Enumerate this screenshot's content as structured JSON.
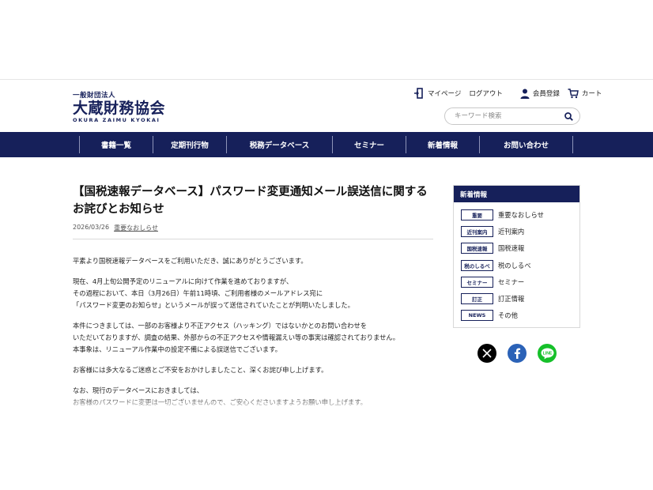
{
  "header": {
    "logo_small": "一般財団法人",
    "logo_big": "大蔵財務協会",
    "logo_roman": "OKURA ZAIMU KYOKAI",
    "mypage": "マイページ",
    "logout": "ログアウト",
    "member": "会員登録",
    "cart": "カート",
    "search_placeholder": "キーワード検索"
  },
  "nav": {
    "items": [
      "書籍一覧",
      "定期刊行物",
      "税務データベース",
      "セミナー",
      "新着情報",
      "お問い合わせ"
    ]
  },
  "article": {
    "title": "【国税速報データベース】パスワード変更通知メール誤送信に関するお詫びとお知らせ",
    "date": "2026/03/26",
    "category": "重要なおしらせ",
    "paragraphs": [
      [
        "平素より国税速報データベースをご利用いただき、誠にありがとうございます。"
      ],
      [
        "現在、4月上旬公開予定のリニューアルに向けて作業を進めておりますが、",
        "その過程において、本日（3月26日）午前11時頃、ご利用者様のメールアドレス宛に",
        "「パスワード変更のお知らせ」というメールが誤って送信されていたことが判明いたしました。"
      ],
      [
        "本件につきましては、一部のお客様より不正アクセス（ハッキング）ではないかとのお問い合わせを",
        "いただいておりますが、調査の結果、外部からの不正アクセスや情報漏えい等の事実は確認されておりません。",
        "本事象は、リニューアル作業中の設定不備による誤送信でございます。"
      ],
      [
        "お客様には多大なるご迷惑とご不安をおかけしましたこと、深くお詫び申し上げます。"
      ],
      [
        "なお、現行のデータベースにおきましては、",
        "お客様のパスワードに変更は一切ございませんので、ご安心くださいますようお願い申し上げます。"
      ]
    ]
  },
  "sidebar": {
    "title": "新着情報",
    "items": [
      {
        "tag": "重要",
        "label": "重要なおしらせ"
      },
      {
        "tag": "近刊案内",
        "label": "近刊案内"
      },
      {
        "tag": "国税速報",
        "label": "国税速報"
      },
      {
        "tag": "税のしるべ",
        "label": "税のしるべ"
      },
      {
        "tag": "セミナー",
        "label": "セミナー"
      },
      {
        "tag": "訂正",
        "label": "訂正情報"
      },
      {
        "tag": "NEWS",
        "label": "その他"
      }
    ]
  },
  "social": {
    "icons": [
      "x-icon",
      "facebook-icon",
      "line-icon"
    ],
    "line_text": "LINE"
  },
  "colors": {
    "brand_navy": "#16205a",
    "facebook": "#2b62b7",
    "line": "#16c02a"
  }
}
